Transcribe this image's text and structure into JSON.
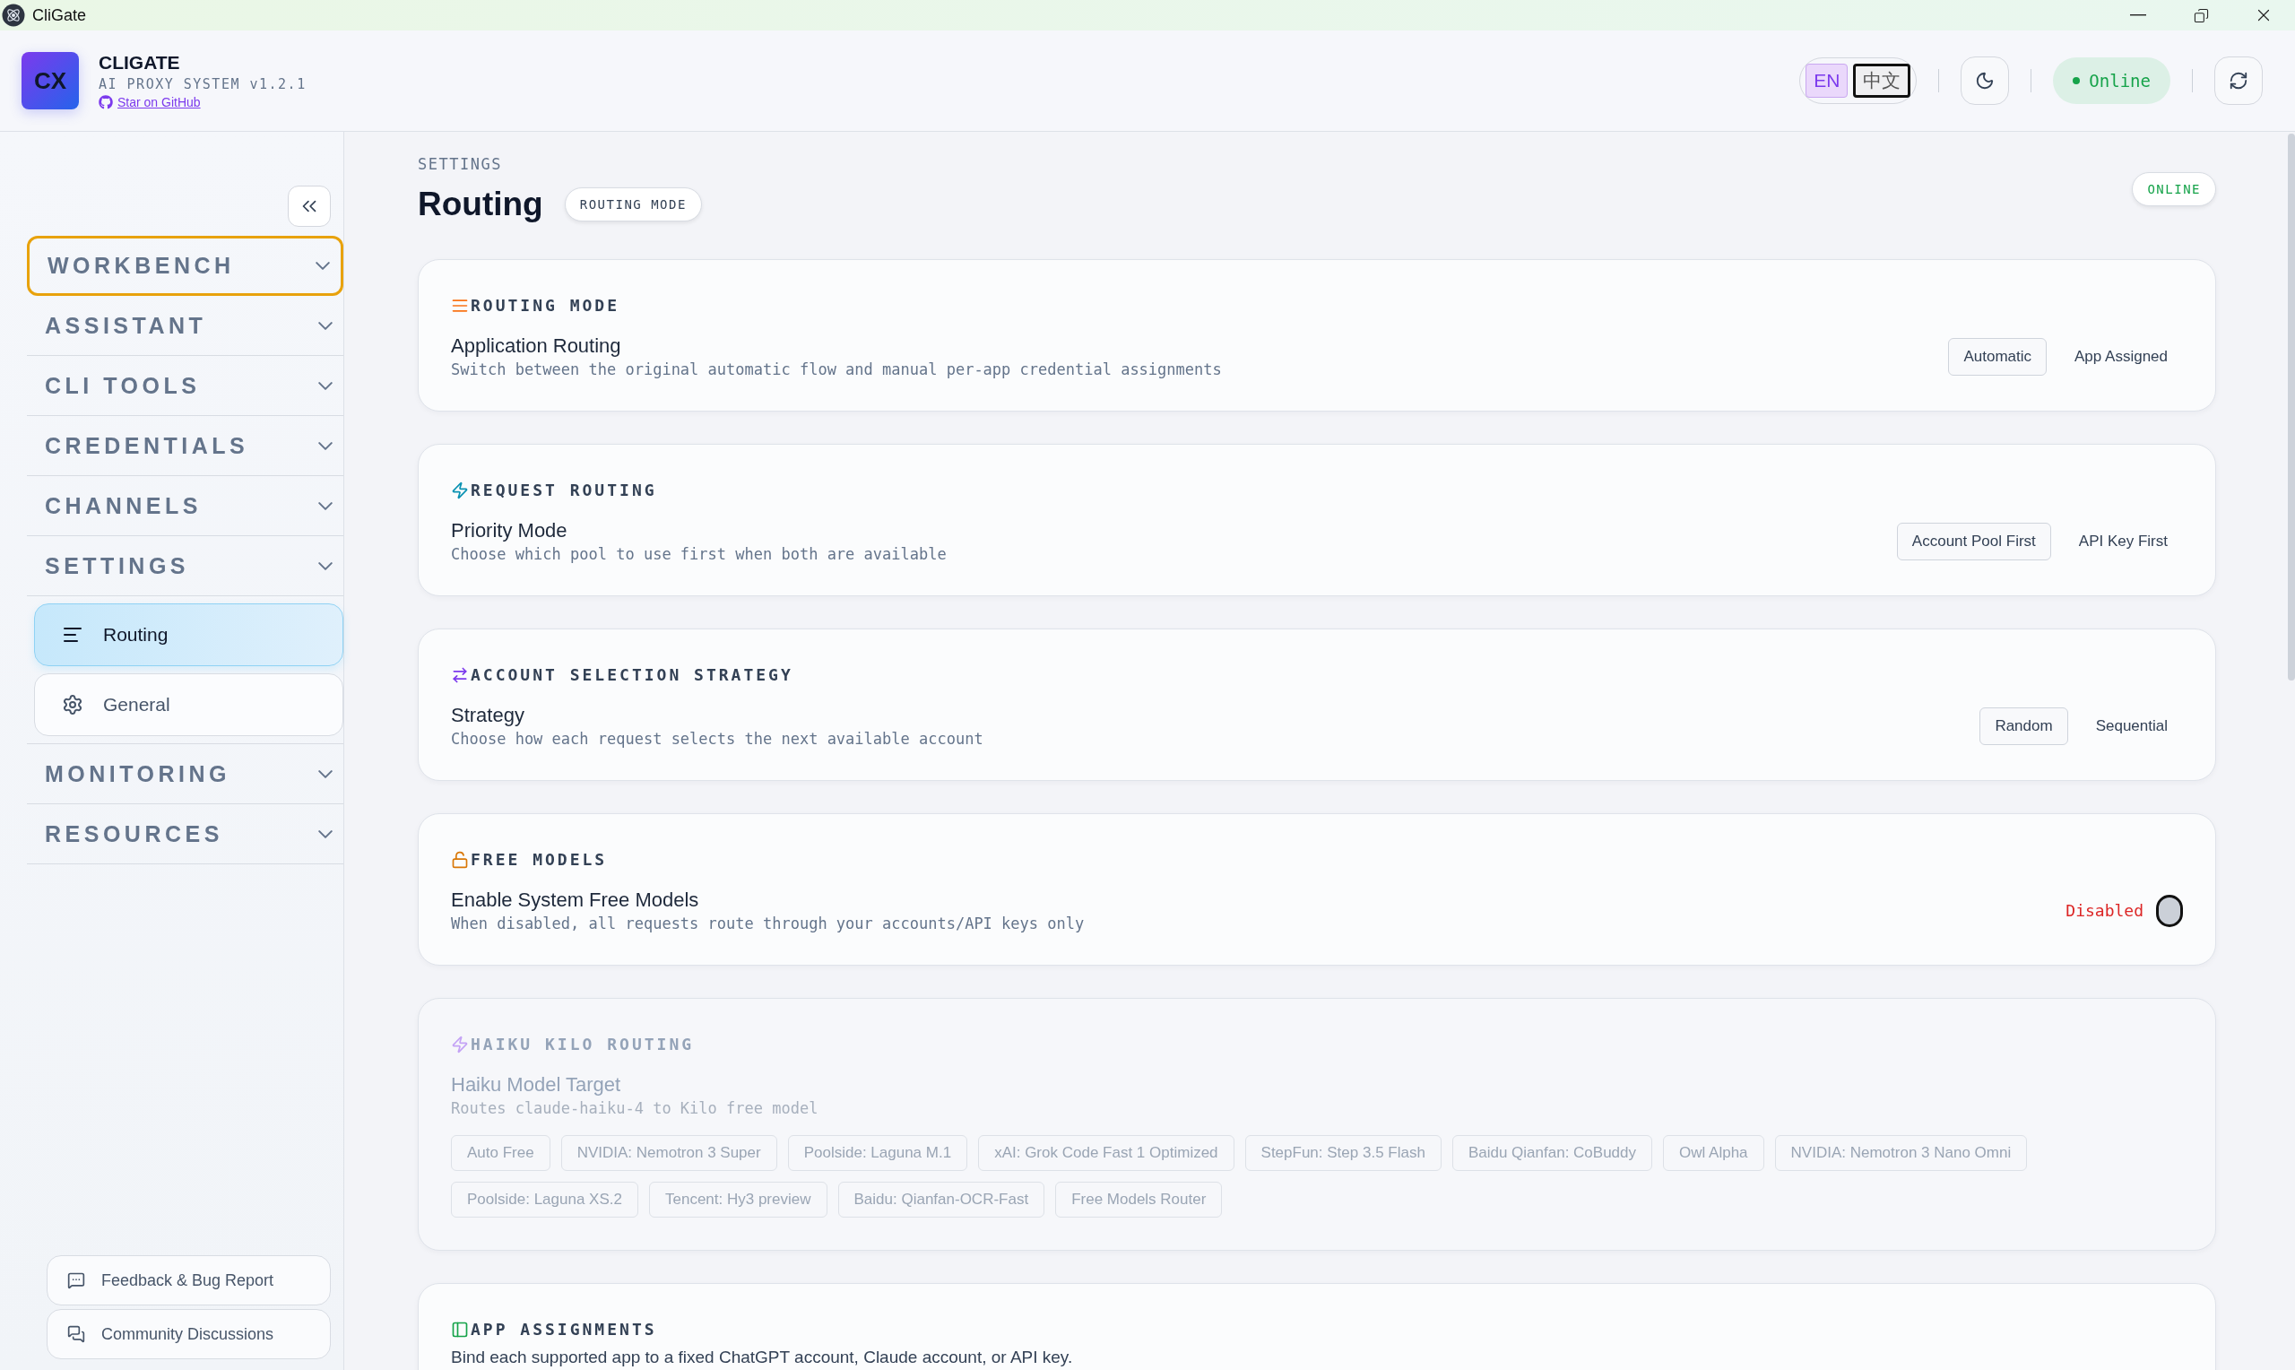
{
  "window": {
    "title": "CliGate"
  },
  "header": {
    "logo_text": "CX",
    "title": "CLIGATE",
    "subtitle": "AI PROXY SYSTEM v1.2.1",
    "link": "Star on GitHub",
    "languages": [
      {
        "label": "EN",
        "selected": true
      },
      {
        "label": "中文",
        "selected": false
      }
    ],
    "status": "Online"
  },
  "sidebar": {
    "sections": [
      {
        "label": "WORKBENCH",
        "focused": true
      },
      {
        "label": "ASSISTANT",
        "focused": false
      },
      {
        "label": "CLI TOOLS",
        "focused": false
      },
      {
        "label": "CREDENTIALS",
        "focused": false
      },
      {
        "label": "CHANNELS",
        "focused": false
      },
      {
        "label": "SETTINGS",
        "focused": false,
        "children": [
          {
            "label": "Routing",
            "kind": "lines",
            "selected": true
          },
          {
            "label": "General",
            "kind": "gear",
            "selected": false
          }
        ]
      },
      {
        "label": "MONITORING",
        "focused": false
      },
      {
        "label": "RESOURCES",
        "focused": false
      }
    ],
    "footer_links": [
      {
        "label": "Feedback & Bug Report",
        "kind": "feedback"
      },
      {
        "label": "Community Discussions",
        "kind": "discussion"
      }
    ]
  },
  "main": {
    "breadcrumb": "SETTINGS",
    "title": "Routing",
    "mode_badge": "ROUTING MODE",
    "status_badge": "ONLINE",
    "cards": [
      {
        "kind": "segmented",
        "color": "#f97316",
        "heading": "ROUTING MODE",
        "label": "Application Routing",
        "description": "Switch between the original automatic flow and manual per-app credential assignments",
        "disabled": false,
        "options": [
          {
            "label": "Automatic",
            "selected": true
          },
          {
            "label": "App Assigned",
            "selected": false
          }
        ]
      },
      {
        "kind": "segmented",
        "color": "#0891b2",
        "heading": "REQUEST ROUTING",
        "label": "Priority Mode",
        "description": "Choose which pool to use first when both are available",
        "disabled": false,
        "options": [
          {
            "label": "Account Pool First",
            "selected": true
          },
          {
            "label": "API Key First",
            "selected": false
          }
        ]
      },
      {
        "kind": "segmented",
        "color": "#7c3aed",
        "heading": "ACCOUNT SELECTION STRATEGY",
        "label": "Strategy",
        "description": "Choose how each request selects the next available account",
        "disabled": false,
        "options": [
          {
            "label": "Random",
            "selected": true
          },
          {
            "label": "Sequential",
            "selected": false
          }
        ]
      },
      {
        "kind": "toggle",
        "color": "#d97706",
        "heading": "FREE MODELS",
        "label": "Enable System Free Models",
        "description": "When disabled, all requests route through your accounts/API keys only",
        "disabled": false,
        "state_text": "Disabled",
        "on": false
      },
      {
        "kind": "chips",
        "color": "#c4a3f5",
        "heading": "HAIKU KILO ROUTING",
        "label": "Haiku Model Target",
        "description": "Routes claude-haiku-4 to Kilo free model",
        "disabled": true,
        "options": [
          {
            "label": "Auto Free",
            "selected": false
          },
          {
            "label": "NVIDIA: Nemotron 3 Super",
            "selected": false
          },
          {
            "label": "Poolside: Laguna M.1",
            "selected": false
          },
          {
            "label": "xAI: Grok Code Fast 1 Optimized",
            "selected": false
          },
          {
            "label": "StepFun: Step 3.5 Flash",
            "selected": false
          },
          {
            "label": "Baidu Qianfan: CoBuddy",
            "selected": false
          },
          {
            "label": "Owl Alpha",
            "selected": false
          },
          {
            "label": "NVIDIA: Nemotron 3 Nano Omni",
            "selected": false
          },
          {
            "label": "Poolside: Laguna XS.2",
            "selected": false
          },
          {
            "label": "Tencent: Hy3 preview",
            "selected": false
          },
          {
            "label": "Baidu: Qianfan-OCR-Fast",
            "selected": false
          },
          {
            "label": "Free Models Router",
            "selected": false
          }
        ]
      },
      {
        "kind": "intro",
        "color": "#16a34a",
        "heading": "APP ASSIGNMENTS",
        "description": "Bind each supported app to a fixed ChatGPT account, Claude account, or API key.",
        "disabled": false
      }
    ]
  }
}
